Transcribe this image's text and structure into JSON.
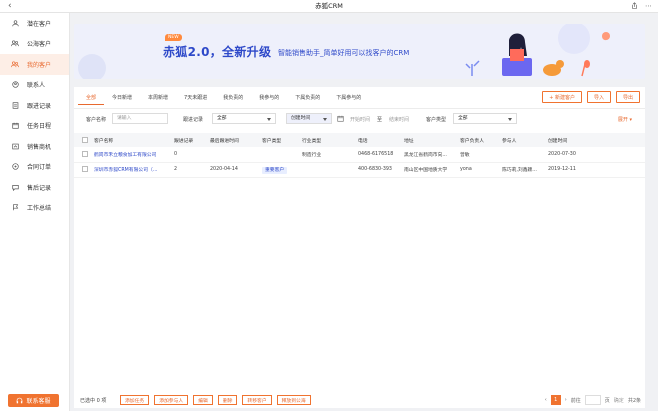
{
  "window": {
    "title": "赤狐CRM"
  },
  "sidebar": {
    "items": [
      {
        "label": "潜在客户",
        "icon": "person-icon"
      },
      {
        "label": "公海客户",
        "icon": "people-icon"
      },
      {
        "label": "我的客户",
        "icon": "my-customer-icon",
        "active": true
      },
      {
        "label": "联系人",
        "icon": "contact-icon"
      },
      {
        "label": "跟进记录",
        "icon": "record-icon"
      },
      {
        "label": "任务日程",
        "icon": "calendar-icon"
      },
      {
        "label": "销售商机",
        "icon": "opportunity-icon"
      },
      {
        "label": "合同订单",
        "icon": "contract-icon"
      },
      {
        "label": "售后记录",
        "icon": "chat-icon"
      },
      {
        "label": "工作总结",
        "icon": "flag-icon"
      }
    ],
    "support_label": "联系客服"
  },
  "banner": {
    "new_tag": "NEW",
    "headline": "赤狐2.0，全新升级",
    "subline": "智能销售助手_简单好用可以找客户的CRM"
  },
  "tabs": [
    "全部",
    "今日新增",
    "本周新增",
    "7天未跟进",
    "我负责的",
    "我参与的",
    "下属负责的",
    "下属参与的"
  ],
  "actions": {
    "new_customer": "+ 新建客户",
    "import": "导入",
    "export": "导出"
  },
  "filters": {
    "name_label": "客户名称",
    "name_placeholder": "请输入",
    "follow_label": "跟进记录",
    "follow_value": "全部",
    "time_value": "创建时间",
    "start_placeholder": "开始时间",
    "range_sep": "至",
    "end_placeholder": "结束时间",
    "type_label": "客户类型",
    "type_value": "全部",
    "expand_label": "展开"
  },
  "table": {
    "columns": [
      "客户名称",
      "跟进记录",
      "最后跟进时间",
      "客户类型",
      "行业类型",
      "电话",
      "地址",
      "客户负责人",
      "参与人",
      "创建时间"
    ],
    "rows": [
      {
        "name": "鹤岗市禾立粮食加工有限公司",
        "follow": "0",
        "last_follow": "",
        "type": "",
        "industry": "制造行业",
        "phone": "0468-6176518",
        "address": "黑龙江省鹤岗市向...",
        "owner": "曾敏",
        "participant": "",
        "created": "2020-07-30"
      },
      {
        "name": "深圳市赤狐CRM有限公司（...",
        "follow": "2",
        "last_follow": "2020-04-14",
        "type": "重要客户",
        "industry": "",
        "phone": "400-6830-393",
        "address": "南山区中国地质大学",
        "owner": "yona",
        "participant": "陈巧莉,刘鑫颖...",
        "created": "2019-12-11"
      }
    ]
  },
  "footer": {
    "selected": "已选中 0 项",
    "buttons": [
      "添加任务",
      "添加参与人",
      "编辑",
      "删除",
      "转移客户",
      "释放到公海"
    ],
    "page": "1",
    "goto_label": "前往",
    "page_unit": "页",
    "confirm": "确定",
    "total": "共2条"
  }
}
